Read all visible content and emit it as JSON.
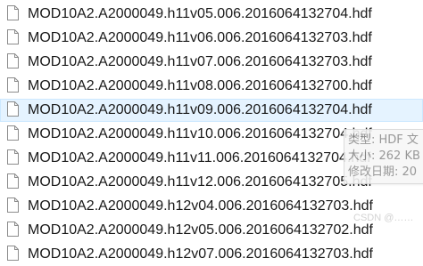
{
  "files": [
    {
      "name": "MOD10A2.A2000049.h11v05.006.2016064132704.hdf",
      "icon": "file-icon"
    },
    {
      "name": "MOD10A2.A2000049.h11v06.006.2016064132703.hdf",
      "icon": "file-icon"
    },
    {
      "name": "MOD10A2.A2000049.h11v07.006.2016064132703.hdf",
      "icon": "file-icon"
    },
    {
      "name": "MOD10A2.A2000049.h11v08.006.2016064132700.hdf",
      "icon": "file-icon"
    },
    {
      "name": "MOD10A2.A2000049.h11v09.006.2016064132704.hdf",
      "icon": "file-icon",
      "state": "hovered"
    },
    {
      "name": "MOD10A2.A2000049.h11v10.006.2016064132704.hdf",
      "icon": "file-icon"
    },
    {
      "name": "MOD10A2.A2000049.h11v11.006.2016064132704.hdf",
      "icon": "file-icon"
    },
    {
      "name": "MOD10A2.A2000049.h11v12.006.2016064132705.hdf",
      "icon": "file-icon"
    },
    {
      "name": "MOD10A2.A2000049.h12v04.006.2016064132703.hdf",
      "icon": "file-icon"
    },
    {
      "name": "MOD10A2.A2000049.h12v05.006.2016064132702.hdf",
      "icon": "file-icon"
    },
    {
      "name": "MOD10A2.A2000049.h12v07.006.2016064132703.hdf",
      "icon": "file-icon"
    }
  ],
  "tooltip": {
    "type_line": "类型: HDF 文",
    "size_line": "大小: 262 KB",
    "modified_line": "修改日期: 20"
  },
  "watermark": "CSDN @……",
  "colors": {
    "hover_background": "#e5f3ff",
    "hover_border": "#cce8ff",
    "text": "#1a1a1a"
  }
}
